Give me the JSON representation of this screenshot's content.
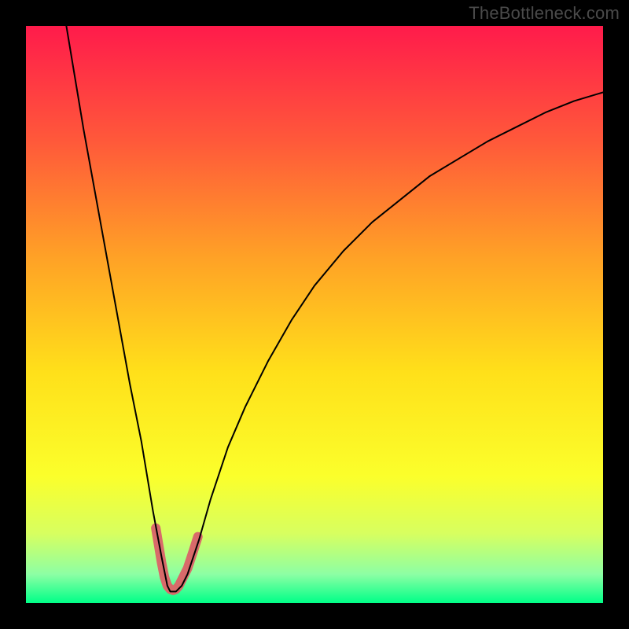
{
  "watermark": {
    "text": "TheBottleneck.com"
  },
  "chart_data": {
    "type": "line",
    "title": "",
    "xlabel": "",
    "ylabel": "",
    "xlim": [
      0,
      100
    ],
    "ylim": [
      0,
      100
    ],
    "grid": false,
    "legend": false,
    "background_gradient": {
      "stops": [
        {
          "offset": 0.0,
          "color": "#ff1b4b"
        },
        {
          "offset": 0.2,
          "color": "#ff593a"
        },
        {
          "offset": 0.4,
          "color": "#ffa126"
        },
        {
          "offset": 0.6,
          "color": "#ffe01a"
        },
        {
          "offset": 0.78,
          "color": "#fbff2b"
        },
        {
          "offset": 0.88,
          "color": "#d7ff60"
        },
        {
          "offset": 0.95,
          "color": "#8dffa4"
        },
        {
          "offset": 1.0,
          "color": "#00ff88"
        }
      ]
    },
    "minimum_x": 25,
    "series": [
      {
        "name": "main-curve",
        "color": "#000000",
        "stroke_width": 2,
        "data": [
          {
            "x": 7,
            "y": 100
          },
          {
            "x": 8.5,
            "y": 91
          },
          {
            "x": 10,
            "y": 82
          },
          {
            "x": 12,
            "y": 71
          },
          {
            "x": 14,
            "y": 60
          },
          {
            "x": 16,
            "y": 49
          },
          {
            "x": 18,
            "y": 38
          },
          {
            "x": 20,
            "y": 28
          },
          {
            "x": 22,
            "y": 16
          },
          {
            "x": 23.5,
            "y": 8
          },
          {
            "x": 24.5,
            "y": 3
          },
          {
            "x": 25,
            "y": 2
          },
          {
            "x": 25.5,
            "y": 2
          },
          {
            "x": 26,
            "y": 2
          },
          {
            "x": 27,
            "y": 3
          },
          {
            "x": 28,
            "y": 5
          },
          {
            "x": 30,
            "y": 11
          },
          {
            "x": 32,
            "y": 18
          },
          {
            "x": 35,
            "y": 27
          },
          {
            "x": 38,
            "y": 34
          },
          {
            "x": 42,
            "y": 42
          },
          {
            "x": 46,
            "y": 49
          },
          {
            "x": 50,
            "y": 55
          },
          {
            "x": 55,
            "y": 61
          },
          {
            "x": 60,
            "y": 66
          },
          {
            "x": 65,
            "y": 70
          },
          {
            "x": 70,
            "y": 74
          },
          {
            "x": 75,
            "y": 77
          },
          {
            "x": 80,
            "y": 80
          },
          {
            "x": 85,
            "y": 82.5
          },
          {
            "x": 90,
            "y": 85
          },
          {
            "x": 95,
            "y": 87
          },
          {
            "x": 100,
            "y": 88.5
          }
        ]
      },
      {
        "name": "highlight-band",
        "color": "#d86a6a",
        "stroke_width": 12,
        "data": [
          {
            "x": 22.5,
            "y": 13
          },
          {
            "x": 23,
            "y": 10
          },
          {
            "x": 23.5,
            "y": 7
          },
          {
            "x": 24,
            "y": 4.5
          },
          {
            "x": 24.5,
            "y": 3
          },
          {
            "x": 25,
            "y": 2.4
          },
          {
            "x": 25.5,
            "y": 2.2
          },
          {
            "x": 26,
            "y": 2.4
          },
          {
            "x": 26.5,
            "y": 3
          },
          {
            "x": 27,
            "y": 4
          },
          {
            "x": 28,
            "y": 6
          },
          {
            "x": 29,
            "y": 9
          },
          {
            "x": 29.8,
            "y": 11.5
          }
        ]
      }
    ]
  }
}
